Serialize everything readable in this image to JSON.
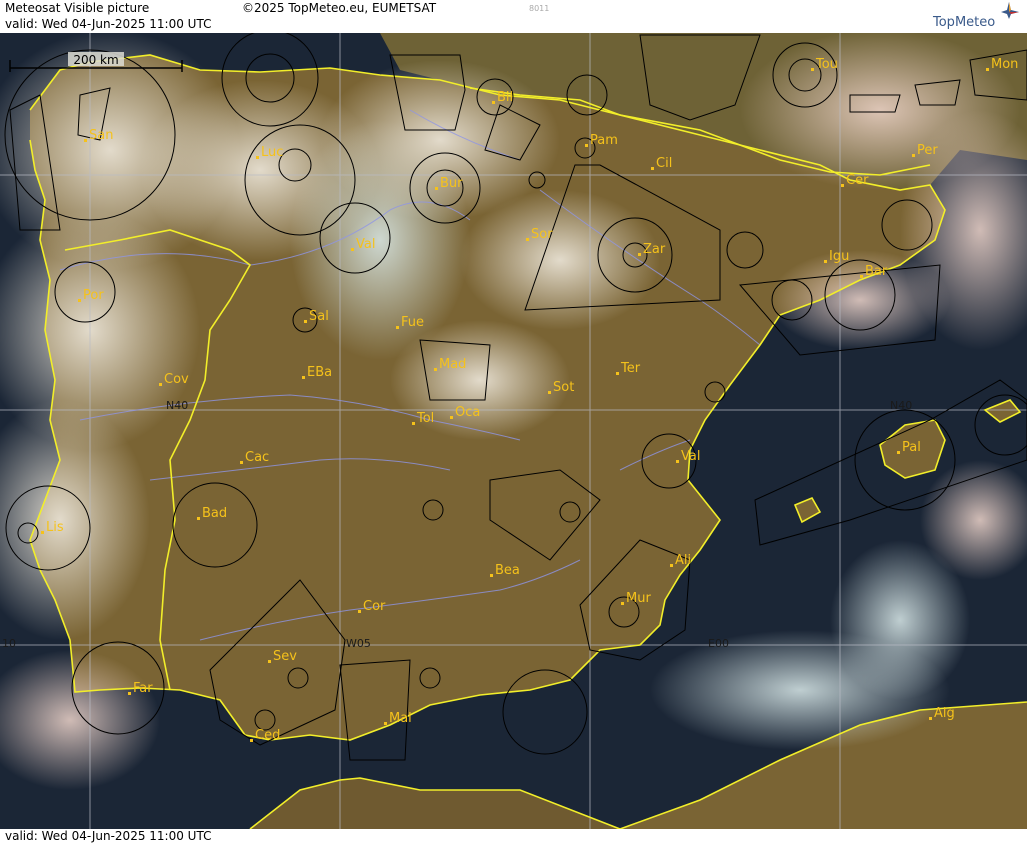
{
  "header": {
    "title": "Meteosat Visible picture",
    "valid": "valid:  Wed  04-Jun-2025  11:00 UTC",
    "copyright": "©2025 TopMeteo.eu, EUMETSAT",
    "code": "8011",
    "logo": "TopMeteo"
  },
  "footer": {
    "valid": "valid:  Wed  04-Jun-2025  11:00 UTC"
  },
  "scale_bar": "200 km",
  "grid_labels": {
    "lat40_west": "N40",
    "lat40_east": "N40",
    "lon_w10": "10",
    "lon_w05": "W05",
    "lon_e00": "E00"
  },
  "cities": [
    "San",
    "Luc",
    "Bil",
    "Pam",
    "Tou",
    "Mon",
    "Per",
    "Cil",
    "Bur",
    "Sor",
    "Zar",
    "Cer",
    "Igu",
    "Bar",
    "Val",
    "Por",
    "Sal",
    "Fue",
    "Mad",
    "Cov",
    "EBa",
    "Ter",
    "Sot",
    "Tol",
    "Oca",
    "Cac",
    "Val",
    "Pal",
    "Bad",
    "Lis",
    "Bea",
    "Ali",
    "Mur",
    "Cor",
    "Sev",
    "Far",
    "Mal",
    "Ced",
    "Alg"
  ],
  "colors": {
    "coast": "#f2ee2a",
    "label": "#f5c21b",
    "sea": "#1b2636",
    "land": "#7a6434",
    "cloud": "#e6e0d2",
    "grid": "#b9bcc6",
    "river": "#8f95e6"
  }
}
